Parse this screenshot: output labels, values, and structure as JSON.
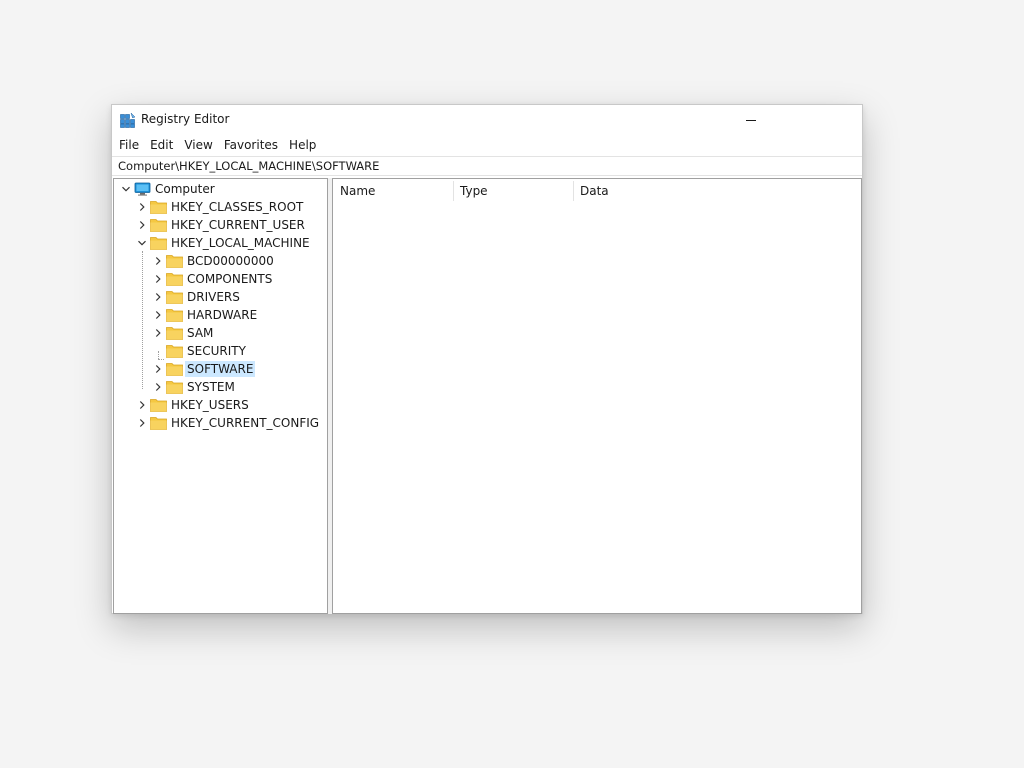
{
  "window": {
    "title": "Registry Editor",
    "app_icon": "registry-editor-icon"
  },
  "menu": {
    "items": [
      "File",
      "Edit",
      "View",
      "Favorites",
      "Help"
    ]
  },
  "address": {
    "value": "Computer\\HKEY_LOCAL_MACHINE\\SOFTWARE"
  },
  "tree": {
    "root": "Computer",
    "hives": {
      "classes_root": "HKEY_CLASSES_ROOT",
      "current_user": "HKEY_CURRENT_USER",
      "local_machine": "HKEY_LOCAL_MACHINE",
      "users": "HKEY_USERS",
      "current_config": "HKEY_CURRENT_CONFIG"
    },
    "local_machine_children": [
      "BCD00000000",
      "COMPONENTS",
      "DRIVERS",
      "HARDWARE",
      "SAM",
      "SECURITY",
      "SOFTWARE",
      "SYSTEM"
    ],
    "selected": "SOFTWARE"
  },
  "list": {
    "columns": [
      "Name",
      "Type",
      "Data"
    ]
  },
  "colors": {
    "folder": "#f5c842",
    "selection": "#cce8ff",
    "computer_icon": "#1e90d6"
  }
}
